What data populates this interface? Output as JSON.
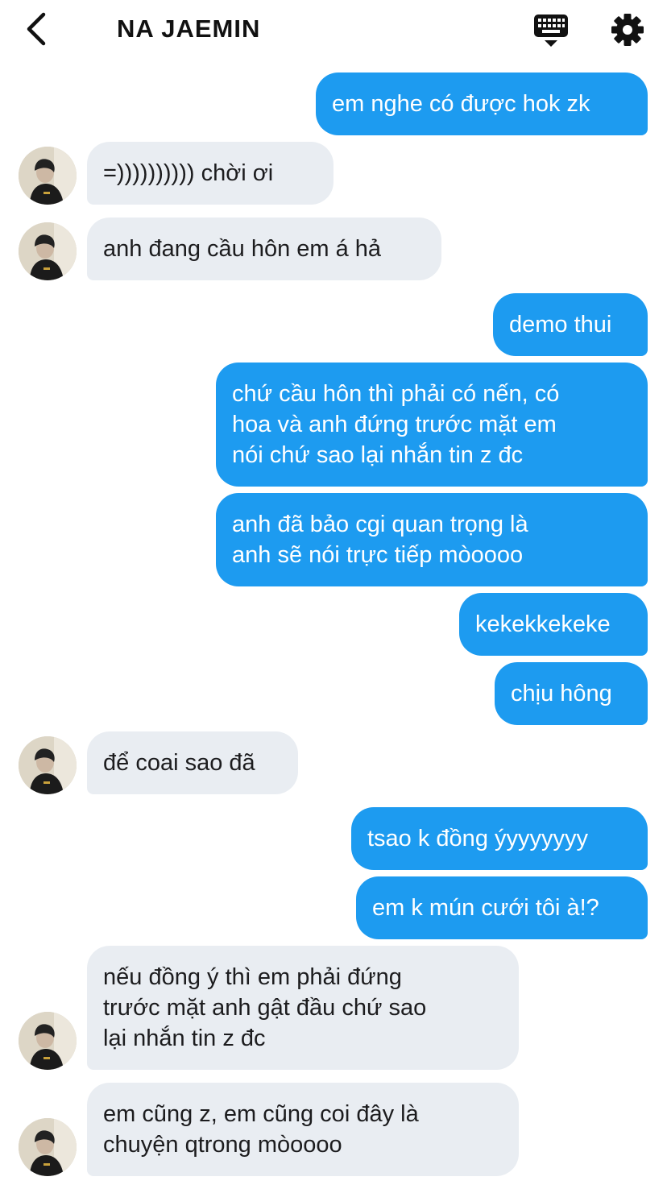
{
  "header": {
    "title": "NA JAEMIN",
    "icons": [
      "back-arrow-icon",
      "keyboard-icon",
      "gear-icon"
    ]
  },
  "messages": [
    {
      "from": "me",
      "text": "em nghe có được hok zk"
    },
    {
      "from": "them",
      "text": "=)))))))))) chời ơi"
    },
    {
      "from": "them",
      "text": "anh đang cầu hôn em á hả"
    },
    {
      "from": "me",
      "text": "demo thui"
    },
    {
      "from": "me",
      "lines": [
        "chứ cầu hôn thì phải có nến, có",
        "hoa và anh đứng trước mặt em",
        "nói chứ sao lại nhắn tin z đc"
      ]
    },
    {
      "from": "me",
      "lines": [
        "anh đã bảo cgi quan trọng là",
        "anh sẽ nói trực tiếp mòoooo"
      ]
    },
    {
      "from": "me",
      "text": "kekekkekeke"
    },
    {
      "from": "me",
      "text": "chịu hông"
    },
    {
      "from": "them",
      "text": "để coai sao đã"
    },
    {
      "from": "me",
      "text": "tsao k đồng ýyyyyyyy"
    },
    {
      "from": "me",
      "text": "em k mún cưới tôi à!?"
    },
    {
      "from": "them",
      "lines": [
        "nếu đồng ý thì em phải đứng",
        "trước mặt anh gật đầu chứ sao",
        "lại nhắn tin z đc"
      ]
    },
    {
      "from": "them",
      "lines": [
        "em cũng z, em cũng coi đây là",
        "chuyện qtrong mòoooo"
      ]
    }
  ],
  "colors": {
    "outgoing_bubble": "#1d9bf0",
    "incoming_bubble": "#e9edf2",
    "outgoing_text": "#ffffff",
    "incoming_text": "#1c1c1e"
  }
}
